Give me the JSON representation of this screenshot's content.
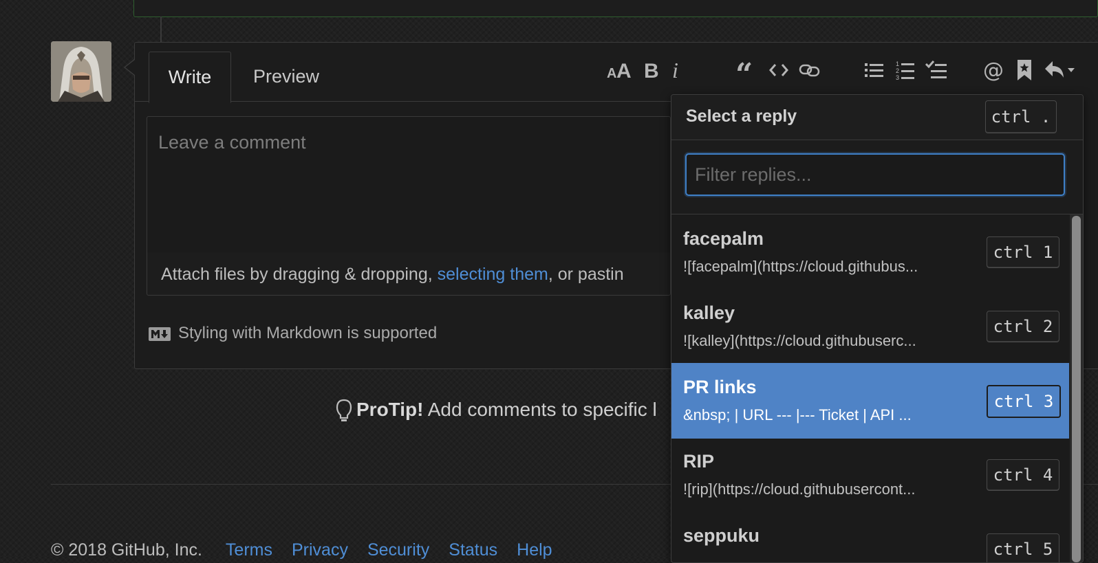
{
  "editor": {
    "tabs": [
      {
        "label": "Write"
      },
      {
        "label": "Preview"
      }
    ],
    "placeholder": "Leave a comment",
    "attach": {
      "before": "Attach files by dragging & dropping, ",
      "link": "selecting them",
      "after": ", or pastin"
    },
    "markdown_note": "Styling with Markdown is supported",
    "toolbar": [
      "text-size-icon",
      "bold-icon",
      "italic-icon",
      "quote-icon",
      "code-icon",
      "link-icon",
      "unordered-list-icon",
      "ordered-list-icon",
      "task-list-icon",
      "mention-icon",
      "bookmark-icon",
      "reply-icon"
    ]
  },
  "protip": {
    "label": "ProTip!",
    "text": " Add comments to specific l"
  },
  "footer": {
    "copyright": "© 2018 GitHub, Inc.",
    "links": [
      "Terms",
      "Privacy",
      "Security",
      "Status",
      "Help"
    ]
  },
  "saved_replies": {
    "title": "Select a reply",
    "shortcut": "ctrl .",
    "filter_placeholder": "Filter replies...",
    "items": [
      {
        "name": "facepalm",
        "body": "![facepalm](https://cloud.githubus...",
        "shortcut": "ctrl 1"
      },
      {
        "name": "kalley",
        "body": "![kalley](https://cloud.githubuserc...",
        "shortcut": "ctrl 2"
      },
      {
        "name": "PR links",
        "body": "&nbsp; | URL --- |--- Ticket | API ...",
        "shortcut": "ctrl 3",
        "selected": true
      },
      {
        "name": "RIP",
        "body": "![rip](https://cloud.githubusercont...",
        "shortcut": "ctrl 4"
      },
      {
        "name": "seppuku",
        "body": "",
        "shortcut": "ctrl 5"
      }
    ]
  },
  "colors": {
    "accent": "#4f8ed6",
    "selected_bg": "#4f83c6",
    "page_bg": "#202020"
  }
}
